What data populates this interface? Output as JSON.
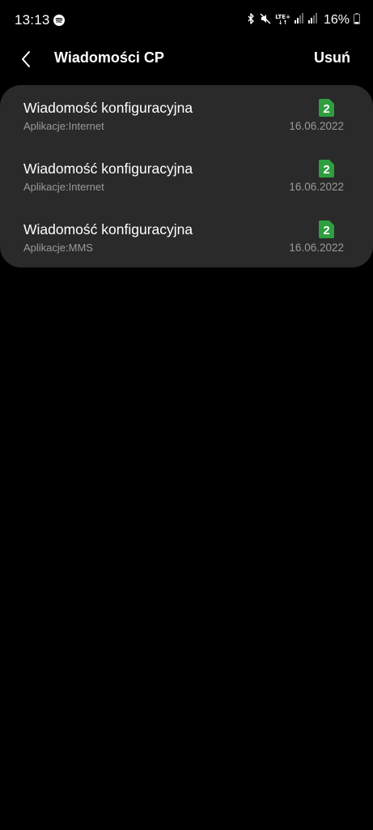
{
  "status_bar": {
    "time": "13:13",
    "battery_percent": "16%",
    "network": "LTE+",
    "icons": [
      "spotify-icon",
      "bluetooth-icon",
      "mute-icon",
      "signal-icon",
      "signal-icon",
      "battery-icon"
    ]
  },
  "header": {
    "title": "Wiadomości CP",
    "delete_label": "Usuń",
    "back_icon": "chevron-left-icon"
  },
  "messages": [
    {
      "title": "Wiadomość konfiguracyjna",
      "subtitle": "Aplikacje:Internet",
      "date": "16.06.2022",
      "sim": "2"
    },
    {
      "title": "Wiadomość konfiguracyjna",
      "subtitle": "Aplikacje:Internet",
      "date": "16.06.2022",
      "sim": "2"
    },
    {
      "title": "Wiadomość konfiguracyjna",
      "subtitle": "Aplikacje:MMS",
      "date": "16.06.2022",
      "sim": "2"
    }
  ],
  "colors": {
    "background": "#000000",
    "card": "#2a2a2a",
    "sim_badge": "#2e9e3e",
    "secondary_text": "#9a9a9a"
  }
}
